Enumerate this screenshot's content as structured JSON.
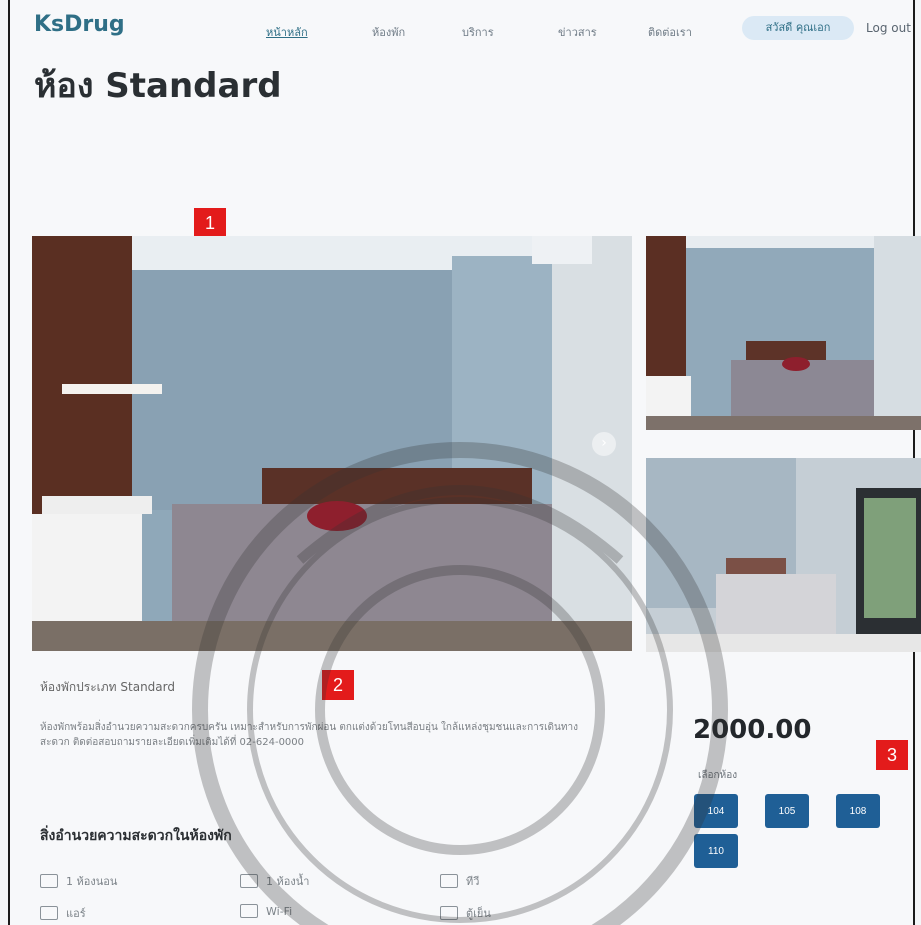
{
  "navbar": {
    "brand": "KsDrug",
    "items": [
      "หน้าหลัก",
      "ห้องพัก",
      "บริการ",
      "ข่าวสาร",
      "ติดต่อเรา"
    ],
    "profile": "สวัสดี คุณเอก",
    "logout": "Log out"
  },
  "page": {
    "title": "ห้อง Standard"
  },
  "markers": [
    "1",
    "2",
    "3"
  ],
  "gallery": {
    "main_alt": "bedroom main image",
    "next_arrow": "›"
  },
  "room": {
    "meta": "ห้องพักประเภท Standard",
    "description": "ห้องพักพร้อมสิ่งอำนวยความสะดวกครบครัน เหมาะสำหรับการพักผ่อน ตกแต่งด้วยโทนสีอบอุ่น ใกล้แหล่งชุมชนและการเดินทางสะดวก ติดต่อสอบถามรายละเอียดเพิ่มเติมได้ที่ 02-624-0000",
    "price": "2000.00",
    "select_label": "เลือกห้อง",
    "room_numbers": [
      "104",
      "105",
      "108",
      "110"
    ]
  },
  "amenities": {
    "title": "สิ่งอำนวยความสะดวกในห้องพัก",
    "items": [
      "1 ห้องนอน",
      "1 ห้องน้ำ",
      "ทีวี",
      "แอร์",
      "Wi-Fi",
      "ตู้เย็น"
    ]
  }
}
